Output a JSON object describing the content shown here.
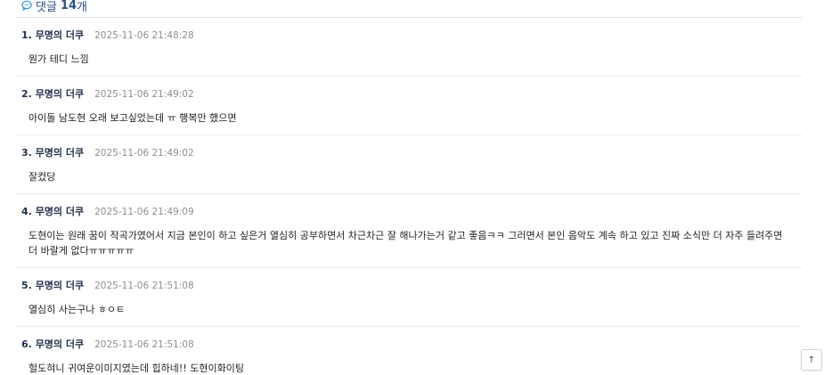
{
  "comments_header": {
    "icon": "chat-icon",
    "label": "댓글",
    "count": "14",
    "unit": "개"
  },
  "comments": [
    {
      "index": "1.",
      "author": "무명의 더쿠",
      "timestamp": "2025-11-06 21:48:28",
      "text": "뭔가 테디 느낌"
    },
    {
      "index": "2.",
      "author": "무명의 더쿠",
      "timestamp": "2025-11-06 21:49:02",
      "text": "아이돌 남도현 오래 보고싶었는데 ㅠ 행복만 했으면"
    },
    {
      "index": "3.",
      "author": "무명의 더쿠",
      "timestamp": "2025-11-06 21:49:02",
      "text": "잘컸당"
    },
    {
      "index": "4.",
      "author": "무명의 더쿠",
      "timestamp": "2025-11-06 21:49:09",
      "text": "도현이는 원래 꿈이 작곡가였어서 지금 본인이 하고 싶은거 열심히 공부하면서 차근차근 잘 해나가는거 같고 좋음ㅋㅋ 그러면서 본인 음악도 계속 하고 있고 진짜 소식만 더 자주 들려주면 더 바랄게 없다ㅠㅠㅠㅠㅠ"
    },
    {
      "index": "5.",
      "author": "무명의 더쿠",
      "timestamp": "2025-11-06 21:51:08",
      "text": "열심히 사는구나 ㅎㅇㅌ"
    },
    {
      "index": "6.",
      "author": "무명의 더쿠",
      "timestamp": "2025-11-06 21:51:08",
      "text": "헐도혀니 귀여운이미지였는데 힙하네!! 도현이화이팅"
    }
  ],
  "scroll_top_button": {
    "icon": "arrow-up-icon",
    "label": "↑"
  }
}
